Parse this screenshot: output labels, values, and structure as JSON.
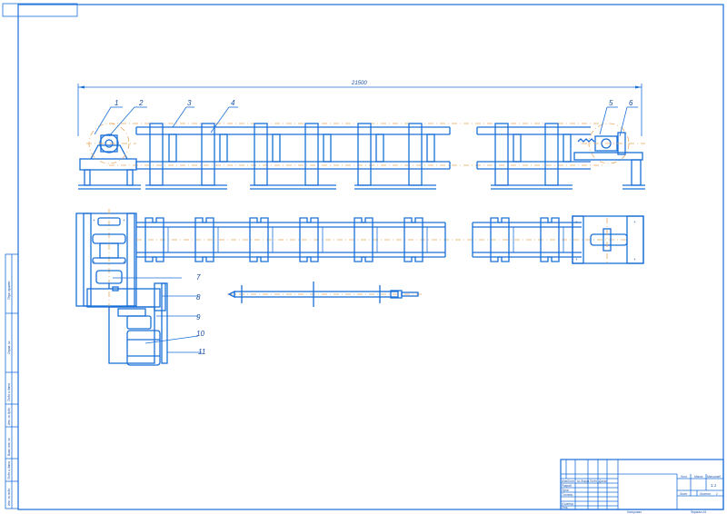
{
  "dimension": {
    "overall_length": "21500"
  },
  "callouts": [
    "1",
    "2",
    "3",
    "4",
    "5",
    "6",
    "7",
    "8",
    "9",
    "10",
    "11"
  ],
  "side_strip": {
    "top_label": "Перв. примен.",
    "mid_label": "Справ. №",
    "bottom_labels": [
      "Подп. и дата",
      "Инв. № дубл.",
      "Взам. инв. №",
      "Подп. и дата",
      "Инв. № подл."
    ]
  },
  "title_block": {
    "rows_left": [
      "Изм.",
      "Лист",
      "№ докум.",
      "Подп.",
      "Дата"
    ],
    "people": [
      "Разраб.",
      "Пров.",
      "Т.контр.",
      "",
      "Н.контр.",
      "Утв."
    ],
    "header_right": [
      "Лит.",
      "Масса",
      "Масштаб"
    ],
    "scale": "1:1",
    "sheet_label": "Лист",
    "sheets_label": "Листов",
    "sheets_value": "1",
    "bottom_left": "Копировал",
    "bottom_right": "Формат   А1"
  }
}
